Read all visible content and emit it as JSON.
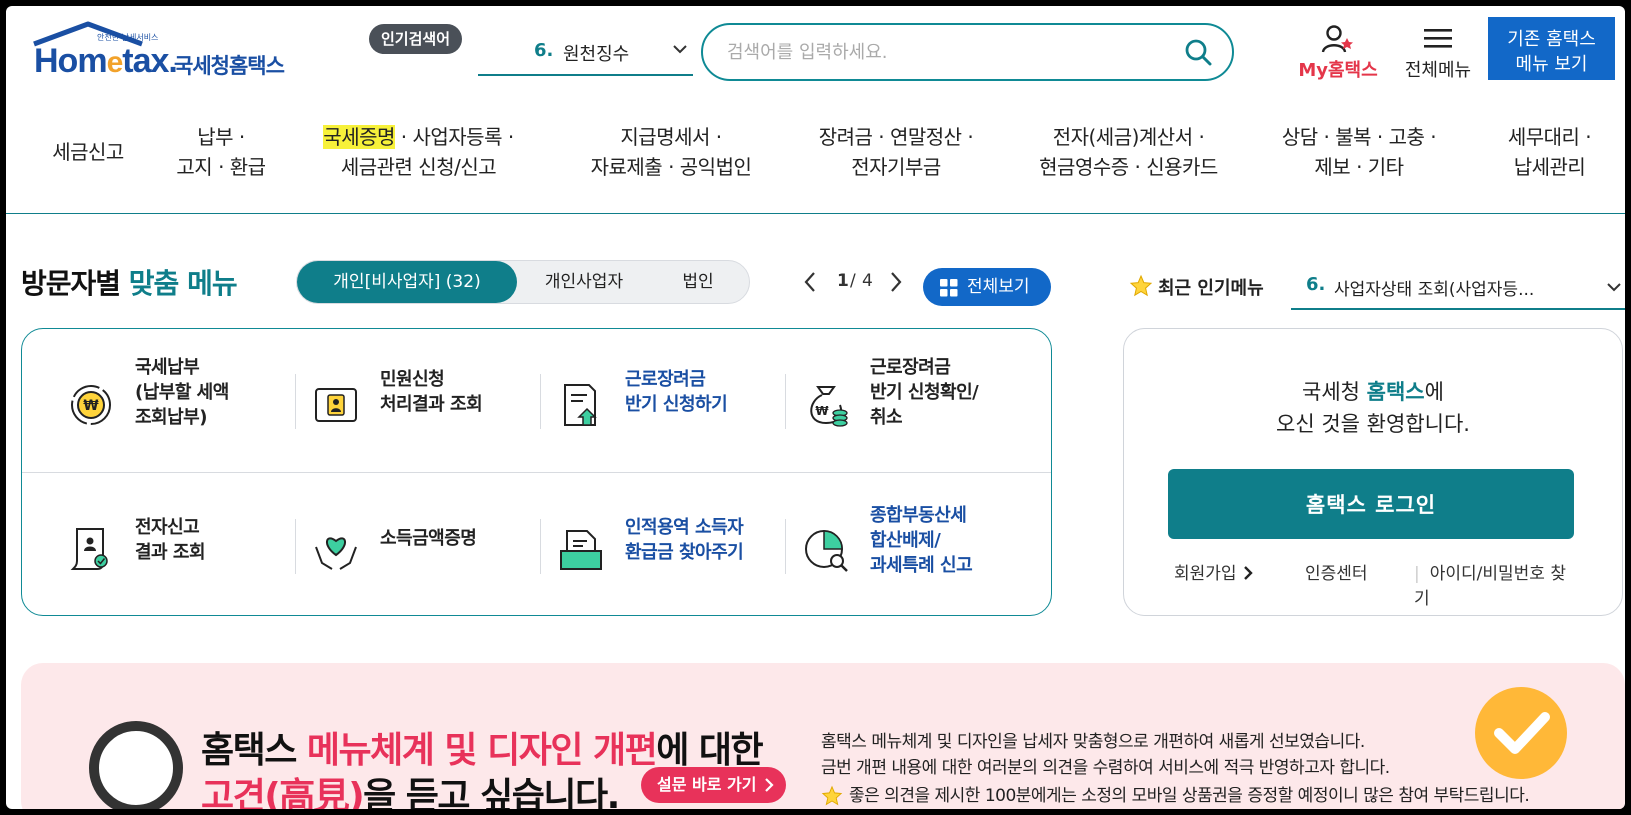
{
  "header": {
    "logo_tag": "안전한 납세서비스",
    "logo_main": "Hom",
    "logo_e": "e",
    "logo_tax": "tax.",
    "logo_kr": "국세청홈택스",
    "popular_badge": "인기검색어",
    "popular_num": "6.",
    "popular_text": "원천징수",
    "search_placeholder": "검색어를 입력하세요.",
    "my_hometax": "My홈택스",
    "all_menu": "전체메뉴",
    "old_hometax_line1": "기존 홈택스",
    "old_hometax_line2": "메뉴 보기"
  },
  "gnb": [
    {
      "line1": "세금신고",
      "line2": ""
    },
    {
      "line1": "납부 ·",
      "line2": "고지 · 환급"
    },
    {
      "line1_hl": "국세증명",
      "line1": " · 사업자등록 ·",
      "line2": "세금관련 신청/신고"
    },
    {
      "line1": "지급명세서 ·",
      "line2": "자료제출 · 공익법인"
    },
    {
      "line1": "장려금 · 연말정산 ·",
      "line2": "전자기부금"
    },
    {
      "line1": "전자(세금)계산서 ·",
      "line2": "현금영수증 · 신용카드"
    },
    {
      "line1": "상담 · 불복 · 고충 ·",
      "line2": "제보 · 기타"
    },
    {
      "line1": "세무대리 ·",
      "line2": "납세관리"
    }
  ],
  "visitor": {
    "title_a": "방문자별",
    "title_b": "맞춤 메뉴",
    "tabs": [
      "개인[비사업자] (32)",
      "개인사업자",
      "법인"
    ],
    "page_current": "1",
    "page_sep": "/",
    "page_total": "4",
    "view_all": "전체보기",
    "tiles": [
      {
        "l1": "국세납부",
        "l2": "(납부할 세액",
        "l3": "조회납부)"
      },
      {
        "l1": "민원신청",
        "l2": "처리결과 조회",
        "l3": ""
      },
      {
        "l1": "근로장려금",
        "l2": "반기 신청하기",
        "l3": ""
      },
      {
        "l1": "근로장려금",
        "l2": "반기 신청확인/",
        "l3": "취소"
      },
      {
        "l1": "전자신고",
        "l2": "결과 조회",
        "l3": ""
      },
      {
        "l1": "소득금액증명",
        "l2": "",
        "l3": ""
      },
      {
        "l1": "인적용역 소득자",
        "l2": "환급금 찾아주기",
        "l3": ""
      },
      {
        "l1": "종합부동산세",
        "l2": "합산배제/",
        "l3": "과세특례 신고"
      }
    ]
  },
  "recent": {
    "title": "최근 인기메뉴",
    "num": "6.",
    "text": "사업자상태 조회(사업자등..."
  },
  "login": {
    "welcome_a": "국세청 ",
    "welcome_b": "홈택스",
    "welcome_c": "에",
    "welcome_line2": "오신 것을 환영합니다.",
    "button": "홈택스 로그인",
    "join": "회원가입",
    "cert": "인증센터",
    "find": "아이디/비밀번호 찾기"
  },
  "banner": {
    "h1_a": "홈택스 ",
    "h1_b": "메뉴체계 및 디자인 개편",
    "h1_c": "에 대한",
    "h2_a": "고견(高見)",
    "h2_b": "을 듣고 싶습니다.",
    "survey": "설문 바로 가기",
    "p1": "홈택스 메뉴체계 및 디자인을 납세자 맞춤형으로 개편하여 새롭게 선보였습니다.",
    "p2": "금번 개편 내용에 대한 여러분의 의견을 수렴하여 서비스에 적극 반영하고자 합니다.",
    "p3": "좋은 의견을 제시한 100분에게는 소정의 모바일 상품권을 증정할 예정이니 많은 참여 부탁드립니다."
  },
  "colors": {
    "teal": "#0f7e8a",
    "blue": "#1268c8",
    "pink": "#e8325a",
    "highlight": "#f7f13a"
  }
}
